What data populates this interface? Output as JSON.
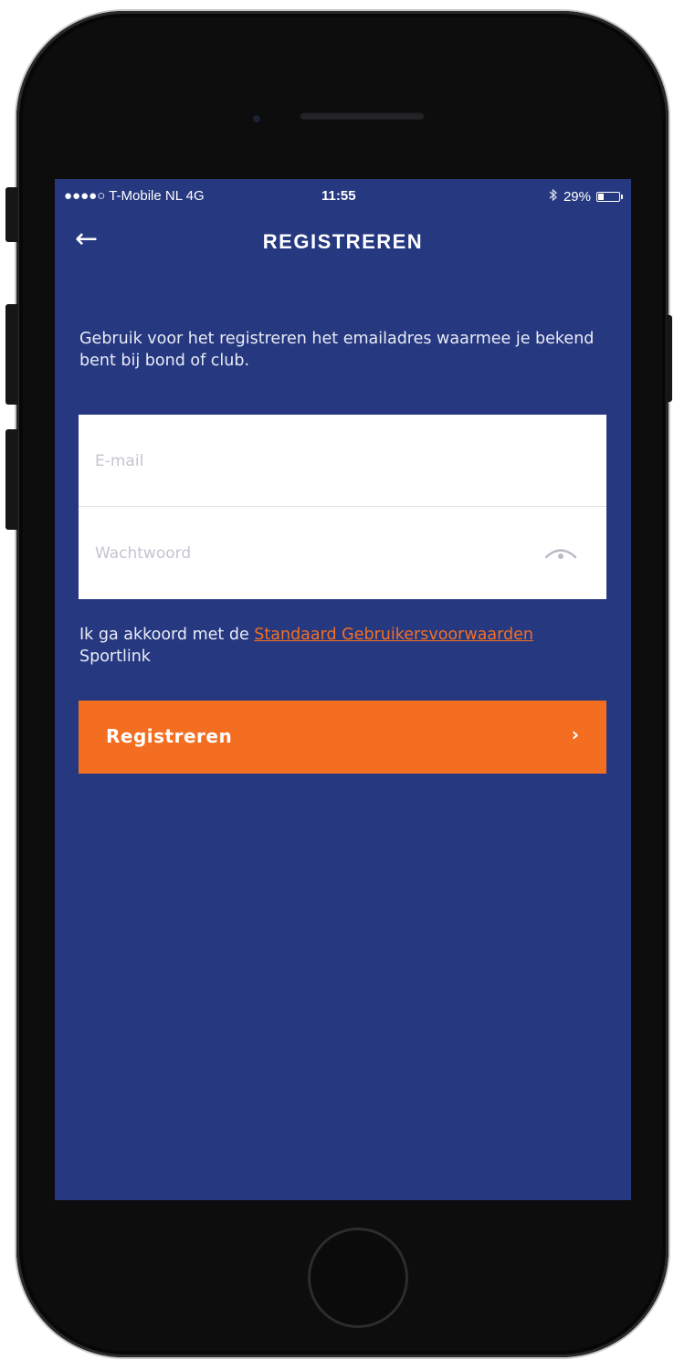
{
  "statusbar": {
    "carrier": "●●●●○ T-Mobile NL  4G",
    "time": "11:55",
    "bluetooth_icon": "bluetooth-icon",
    "battery": "29%",
    "battery_level": 0.29
  },
  "navbar": {
    "back_icon": "arrow-left-icon",
    "back_glyph": "←",
    "title": "REGISTREREN"
  },
  "intro": {
    "text": "Gebruik voor het registreren het emailadres waarmee je bekend bent bij bond of club."
  },
  "form": {
    "email_placeholder": "E-mail",
    "email_value": "",
    "password_placeholder": "Wachtwoord",
    "password_value": "",
    "password_toggle_icon": "eye-icon"
  },
  "terms": {
    "prefix": "Ik ga akkoord met de ",
    "link": "Standaard Gebruikersvoorwaarden",
    "suffix": " Sportlink"
  },
  "register_button": {
    "label": "Registreren",
    "chevron": "›"
  },
  "colors": {
    "background": "#263880",
    "accent": "#f36e21",
    "text": "#ffffff"
  }
}
